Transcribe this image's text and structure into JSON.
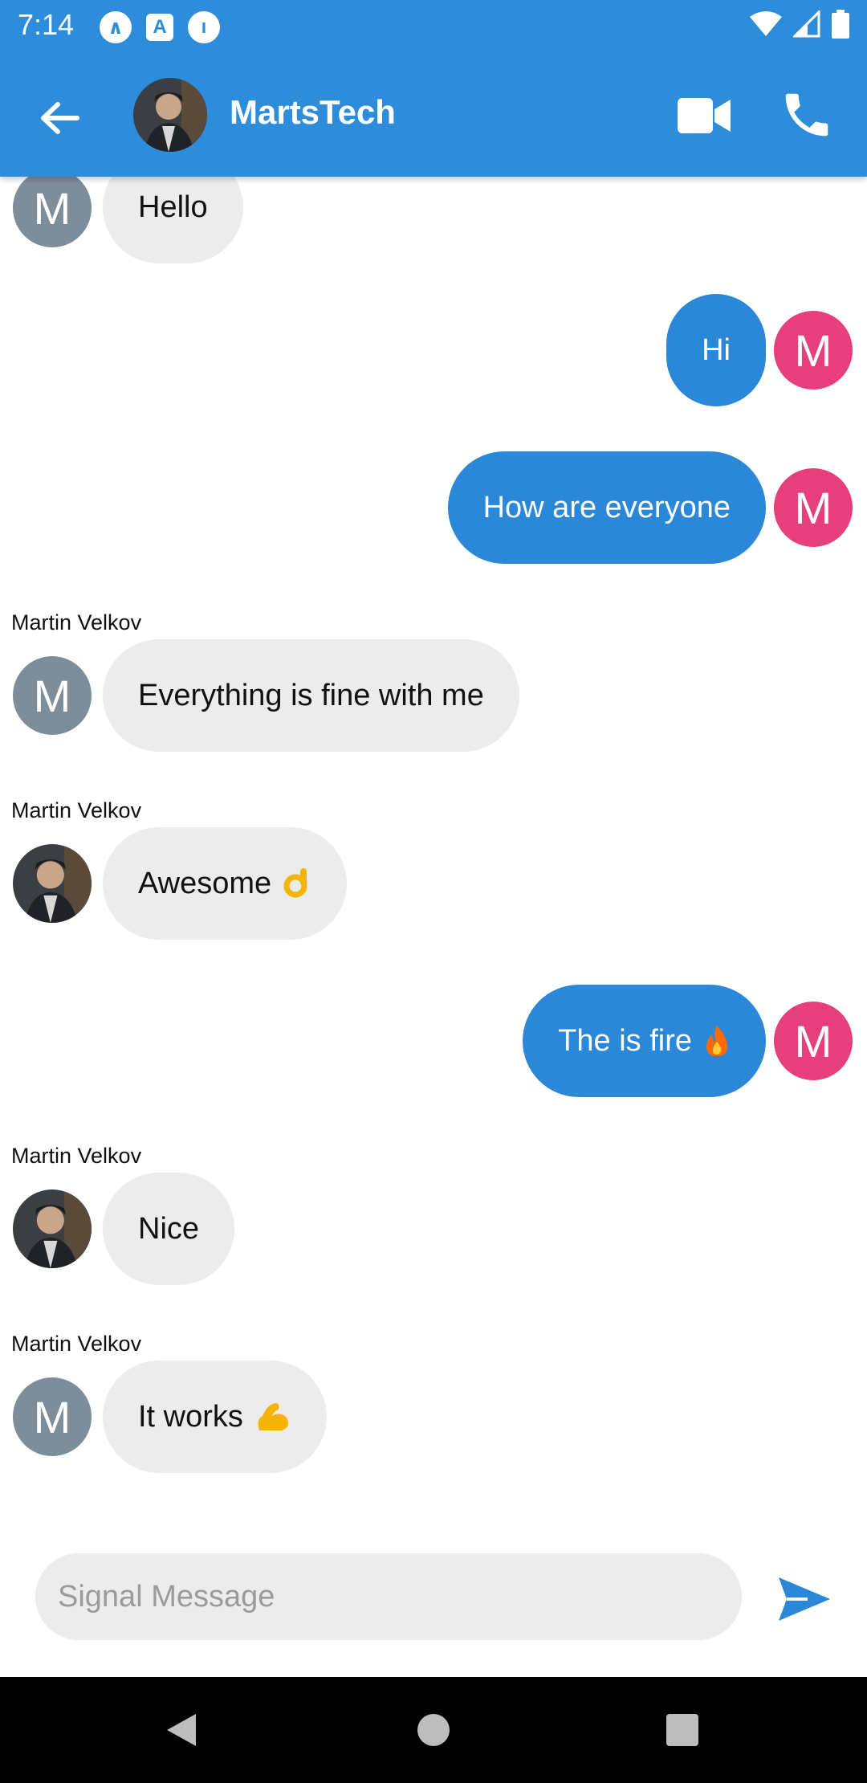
{
  "status_bar": {
    "time": "7:14",
    "left_icons": [
      "app-icon-a",
      "accessibility-icon",
      "app-icon-b"
    ],
    "right_icons": [
      "wifi-icon",
      "signal-icon",
      "battery-icon"
    ]
  },
  "header": {
    "title": "MartsTech",
    "back_icon": "arrow-left-icon",
    "video_icon": "video-camera-icon",
    "call_icon": "phone-icon"
  },
  "messages": [
    {
      "direction": "in",
      "sender": "",
      "avatar": "M",
      "text": "Hello"
    },
    {
      "direction": "out",
      "avatar": "M",
      "text": "Hi"
    },
    {
      "direction": "out",
      "avatar": "M",
      "text": "How are everyone"
    },
    {
      "direction": "in",
      "sender": "Martin Velkov",
      "avatar": "M",
      "text": "Everything is fine with me"
    },
    {
      "direction": "in",
      "sender": "Martin Velkov",
      "avatar": "photo",
      "text": "Awesome",
      "emoji": "ok-hand-icon"
    },
    {
      "direction": "out",
      "avatar": "M",
      "text": "The is fire",
      "emoji": "fire-icon"
    },
    {
      "direction": "in",
      "sender": "Martin Velkov",
      "avatar": "photo",
      "text": "Nice"
    },
    {
      "direction": "in",
      "sender": "Martin Velkov",
      "avatar": "M",
      "text": "It works",
      "emoji": "flexed-biceps-icon"
    }
  ],
  "composer": {
    "placeholder": "Signal Message",
    "value": "",
    "send_icon": "send-icon"
  },
  "colors": {
    "primary": "#2d8ddb",
    "outgoing_bubble": "#2b88d9",
    "incoming_bubble": "#ececec",
    "avatar_gray": "#7d8d9a",
    "avatar_pink": "#e63f7b"
  },
  "nav_bar": [
    "nav-back-icon",
    "nav-home-icon",
    "nav-recents-icon"
  ]
}
